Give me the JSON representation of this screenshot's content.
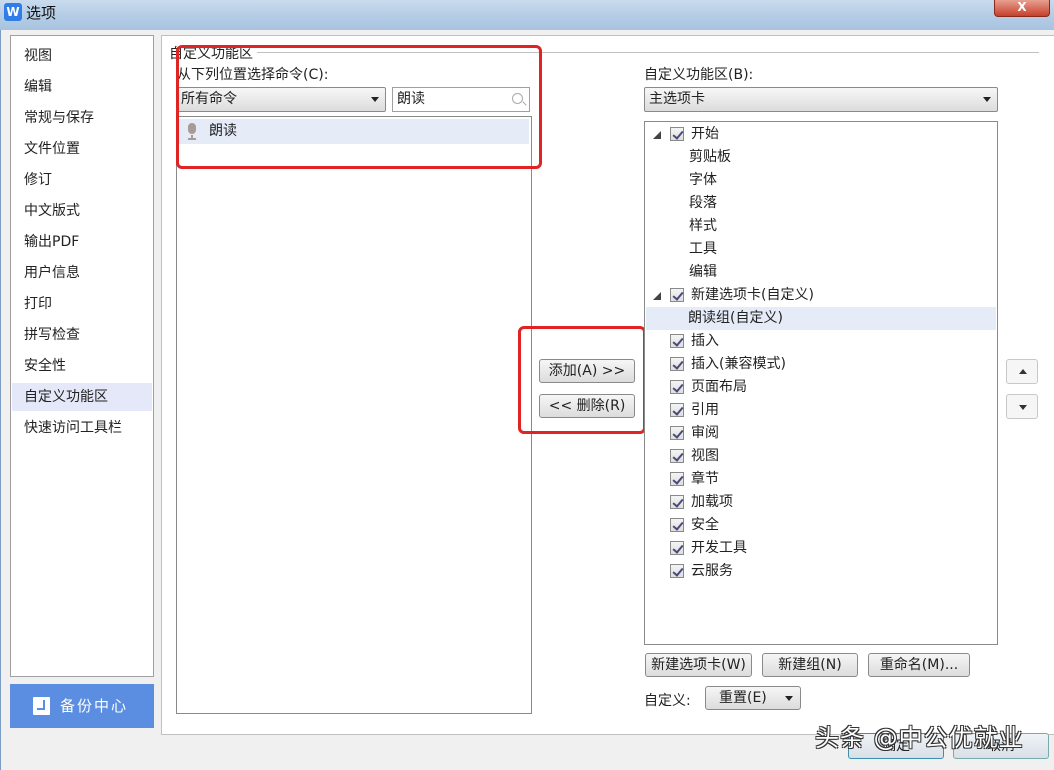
{
  "window": {
    "app_icon": "W",
    "title": "选项",
    "close_label": "X"
  },
  "sidebar": {
    "items": [
      {
        "label": "视图"
      },
      {
        "label": "编辑"
      },
      {
        "label": "常规与保存"
      },
      {
        "label": "文件位置"
      },
      {
        "label": "修订"
      },
      {
        "label": "中文版式"
      },
      {
        "label": "输出PDF"
      },
      {
        "label": "用户信息"
      },
      {
        "label": "打印"
      },
      {
        "label": "拼写检查"
      },
      {
        "label": "安全性"
      },
      {
        "label": "自定义功能区",
        "active": true
      },
      {
        "label": "快速访问工具栏"
      }
    ],
    "backup_label": "备份中心"
  },
  "main": {
    "group_title": "自定义功能区",
    "left": {
      "choose_label": "从下列位置选择命令(C):",
      "source_select": "所有命令",
      "search_value": "朗读",
      "commands": [
        {
          "label": "朗读",
          "icon": "microphone-icon"
        }
      ]
    },
    "middle": {
      "add_label": "添加(A) >>",
      "remove_label": "<< 删除(R)"
    },
    "right": {
      "customize_label": "自定义功能区(B):",
      "tabs_select": "主选项卡",
      "tree": [
        {
          "label": "开始",
          "level": 0,
          "expander": "open",
          "checked": true
        },
        {
          "label": "剪贴板",
          "level": 1,
          "expander": "closed"
        },
        {
          "label": "字体",
          "level": 1,
          "expander": "closed"
        },
        {
          "label": "段落",
          "level": 1,
          "expander": "closed"
        },
        {
          "label": "样式",
          "level": 1,
          "expander": "closed"
        },
        {
          "label": "工具",
          "level": 1,
          "expander": "closed"
        },
        {
          "label": "编辑",
          "level": 1,
          "expander": "closed"
        },
        {
          "label": "新建选项卡(自定义)",
          "level": 0,
          "expander": "open",
          "checked": true
        },
        {
          "label": "朗读组(自定义)",
          "level": 1,
          "expander": "none",
          "selected": true
        },
        {
          "label": "插入",
          "level": 0,
          "expander": "closed",
          "checked": true
        },
        {
          "label": "插入(兼容模式)",
          "level": 0,
          "expander": "closed",
          "checked": true
        },
        {
          "label": "页面布局",
          "level": 0,
          "expander": "closed",
          "checked": true
        },
        {
          "label": "引用",
          "level": 0,
          "expander": "closed",
          "checked": true
        },
        {
          "label": "审阅",
          "level": 0,
          "expander": "closed",
          "checked": true
        },
        {
          "label": "视图",
          "level": 0,
          "expander": "closed",
          "checked": true
        },
        {
          "label": "章节",
          "level": 0,
          "expander": "closed",
          "checked": true
        },
        {
          "label": "加载项",
          "level": 0,
          "expander": "closed",
          "checked": true
        },
        {
          "label": "安全",
          "level": 0,
          "expander": "closed",
          "checked": true
        },
        {
          "label": "开发工具",
          "level": 0,
          "expander": "closed",
          "checked": true
        },
        {
          "label": "云服务",
          "level": 0,
          "expander": "closed",
          "checked": true
        }
      ],
      "new_tab_label": "新建选项卡(W)",
      "new_group_label": "新建组(N)",
      "rename_label": "重命名(M)...",
      "customize_prefix": "自定义:",
      "reset_label": "重置(E)"
    }
  },
  "footer": {
    "ok_label": "确定",
    "cancel_label": "取消"
  },
  "watermark": "头条 @中公优就业",
  "colors": {
    "highlight_box": "#e02424",
    "selection": "#e6ebf8",
    "backup_button": "#5b8ee0"
  }
}
